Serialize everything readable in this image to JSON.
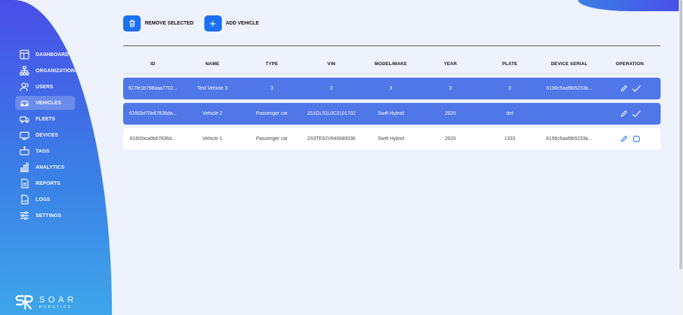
{
  "sidebar": {
    "collapse_glyph": "‹",
    "items": [
      {
        "label": "DASHBOARD",
        "icon": "dashboard-icon"
      },
      {
        "label": "ORGANIZATIONS",
        "icon": "organizations-icon"
      },
      {
        "label": "USERS",
        "icon": "users-icon"
      },
      {
        "label": "VEHICLES",
        "icon": "car-icon",
        "active": true
      },
      {
        "label": "FLEETS",
        "icon": "fleet-icon"
      },
      {
        "label": "DEVICES",
        "icon": "devices-icon"
      },
      {
        "label": "TAGS",
        "icon": "tags-icon"
      },
      {
        "label": "ANALYTICS",
        "icon": "analytics-icon"
      },
      {
        "label": "REPORTS",
        "icon": "reports-icon"
      },
      {
        "label": "LOGS",
        "icon": "logs-icon"
      },
      {
        "label": "SETTINGS",
        "icon": "settings-icon"
      }
    ],
    "logo": {
      "word": "SOAR",
      "sub": "ROBOTICS"
    }
  },
  "toolbar": {
    "remove_label": "REMOVE SELECTED",
    "add_label": "ADD VEHICLE"
  },
  "table": {
    "headers": [
      "ID",
      "NAME",
      "TYPE",
      "VIN",
      "MODEL/MAKE",
      "YEAR",
      "PLATE",
      "DEVICE SERIAL",
      "OPERATION"
    ],
    "rows": [
      {
        "cells": [
          "617fe1b798aaa7702...",
          "Test Vehicle 3",
          "3",
          "3",
          "3",
          "3",
          "3",
          "6156c5aaf9b5233b..."
        ],
        "selected": true
      },
      {
        "cells": [
          "616f2bf70b67836da...",
          "Vehicle 2",
          "Passenger car",
          "JS1GL51L0C2101702",
          "Swift Hybrid",
          "2020",
          "def",
          ""
        ],
        "selected": true
      },
      {
        "cells": [
          "616f2bca0b67836d...",
          "Vehicle 1",
          "Passenger car",
          "2S3TE62V946680036",
          "Swift Hybrid",
          "2020",
          "1333",
          "6156c5aaf9b5233b..."
        ],
        "selected": false
      }
    ]
  },
  "colors": {
    "accent": "#1b6ff2",
    "selected_row": "#5077e8",
    "background": "#eef2fc"
  }
}
